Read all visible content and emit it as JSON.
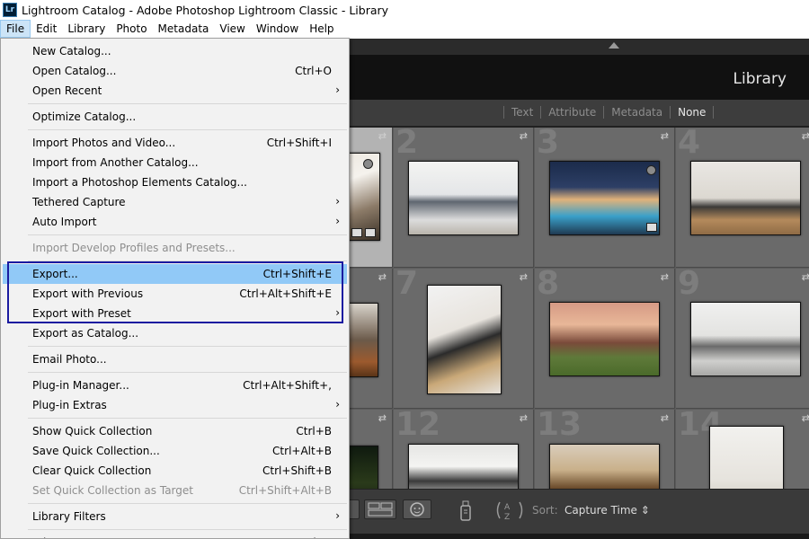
{
  "window": {
    "logo_text": "Lr",
    "title": "Lightroom Catalog - Adobe Photoshop Lightroom Classic - Library"
  },
  "menubar": [
    "File",
    "Edit",
    "Library",
    "Photo",
    "Metadata",
    "View",
    "Window",
    "Help"
  ],
  "module": "Library",
  "filter_bar": {
    "items": [
      "Text",
      "Attribute",
      "Metadata",
      "None"
    ],
    "selected": "None"
  },
  "grid": {
    "cell_numbers": [
      "",
      "2",
      "3",
      "4",
      "",
      "7",
      "8",
      "9",
      "",
      "12",
      "13",
      "14"
    ]
  },
  "toolbar": {
    "sort_label": "Sort:",
    "sort_value": "Capture Time ⇕"
  },
  "file_menu": [
    {
      "label": "New Catalog...",
      "shortcut": ""
    },
    {
      "label": "Open Catalog...",
      "shortcut": "Ctrl+O"
    },
    {
      "label": "Open Recent",
      "shortcut": "",
      "submenu": true
    },
    {
      "sep": true
    },
    {
      "label": "Optimize Catalog...",
      "shortcut": ""
    },
    {
      "sep": true
    },
    {
      "label": "Import Photos and Video...",
      "shortcut": "Ctrl+Shift+I"
    },
    {
      "label": "Import from Another Catalog...",
      "shortcut": ""
    },
    {
      "label": "Import a Photoshop Elements Catalog...",
      "shortcut": ""
    },
    {
      "label": "Tethered Capture",
      "shortcut": "",
      "submenu": true
    },
    {
      "label": "Auto Import",
      "shortcut": "",
      "submenu": true
    },
    {
      "sep": true
    },
    {
      "label": "Import Develop Profiles and Presets...",
      "shortcut": "",
      "disabled": true
    },
    {
      "sep": true
    },
    {
      "label": "Export...",
      "shortcut": "Ctrl+Shift+E",
      "highlighted": true
    },
    {
      "label": "Export with Previous",
      "shortcut": "Ctrl+Alt+Shift+E"
    },
    {
      "label": "Export with Preset",
      "shortcut": "",
      "submenu": true
    },
    {
      "label": "Export as Catalog...",
      "shortcut": ""
    },
    {
      "sep": true
    },
    {
      "label": "Email Photo...",
      "shortcut": ""
    },
    {
      "sep": true
    },
    {
      "label": "Plug-in Manager...",
      "shortcut": "Ctrl+Alt+Shift+,"
    },
    {
      "label": "Plug-in Extras",
      "shortcut": "",
      "submenu": true
    },
    {
      "sep": true
    },
    {
      "label": "Show Quick Collection",
      "shortcut": "Ctrl+B"
    },
    {
      "label": "Save Quick Collection...",
      "shortcut": "Ctrl+Alt+B"
    },
    {
      "label": "Clear Quick Collection",
      "shortcut": "Ctrl+Shift+B"
    },
    {
      "label": "Set Quick Collection as Target",
      "shortcut": "Ctrl+Shift+Alt+B",
      "disabled": true
    },
    {
      "sep": true
    },
    {
      "label": "Library Filters",
      "shortcut": "",
      "submenu": true
    },
    {
      "sep": true
    },
    {
      "label": "Print...",
      "shortcut": "Ctrl+P"
    }
  ]
}
